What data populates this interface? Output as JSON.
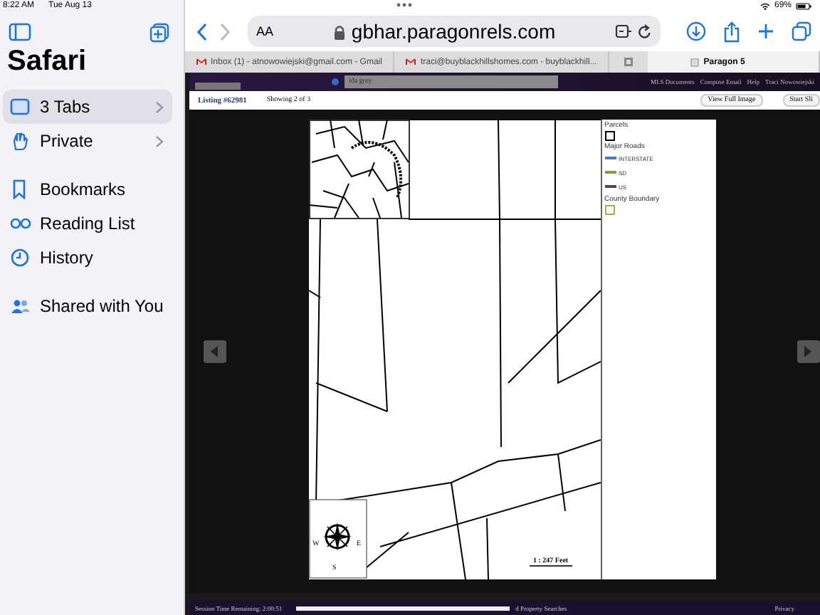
{
  "status_bar": {
    "time": "8:22 AM",
    "date": "Tue Aug 13",
    "battery": "69%"
  },
  "sidebar": {
    "title": "Safari",
    "items": [
      {
        "label": "3 Tabs",
        "selected": true,
        "expandable": true
      },
      {
        "label": "Private",
        "selected": false,
        "expandable": true
      },
      {
        "label": "Bookmarks",
        "selected": false,
        "expandable": false
      },
      {
        "label": "Reading List",
        "selected": false,
        "expandable": false
      },
      {
        "label": "History",
        "selected": false,
        "expandable": false
      },
      {
        "label": "Shared with You",
        "selected": false,
        "expandable": false
      }
    ]
  },
  "toolbar": {
    "text_size": "AA",
    "url": "gbhar.paragonrels.com"
  },
  "tabs": [
    {
      "title": "Inbox (1) - atnowowiejski@gmail.com - Gmail",
      "selected": false
    },
    {
      "title": "traci@buyblackhillshomes.com - buyblackhill...",
      "selected": false
    },
    {
      "title": "Paragon 5",
      "selected": true
    }
  ],
  "page": {
    "header": {
      "search": "ida grey",
      "links": [
        "MLS Documents",
        "Compose Email",
        "Help",
        "Traci Nowowiejski"
      ]
    },
    "listing": {
      "title": "Listing #62981",
      "counter": "Showing 2 of 3",
      "buttons": [
        "View Full Image",
        "Start Sli"
      ]
    },
    "map": {
      "legend": [
        {
          "kind": "heading",
          "label": "Parcels"
        },
        {
          "kind": "box",
          "color": "#000000"
        },
        {
          "kind": "heading",
          "label": "Major Roads"
        },
        {
          "kind": "road",
          "label": "INTERSTATE",
          "color": "#4a78d0"
        },
        {
          "kind": "road",
          "label": "SD",
          "color": "#7aa040"
        },
        {
          "kind": "road",
          "label": "US",
          "color": "#6a3a5a"
        },
        {
          "kind": "heading",
          "label": "County Boundary"
        },
        {
          "kind": "box",
          "color": "#a8b040"
        }
      ],
      "compass": [
        "W",
        "E",
        "S"
      ],
      "scale": "1 : 247 Feet"
    },
    "footer": {
      "session": "Session Time Remaining: 2:00:51",
      "center": "d Property Searches",
      "right": "Privacy"
    }
  }
}
